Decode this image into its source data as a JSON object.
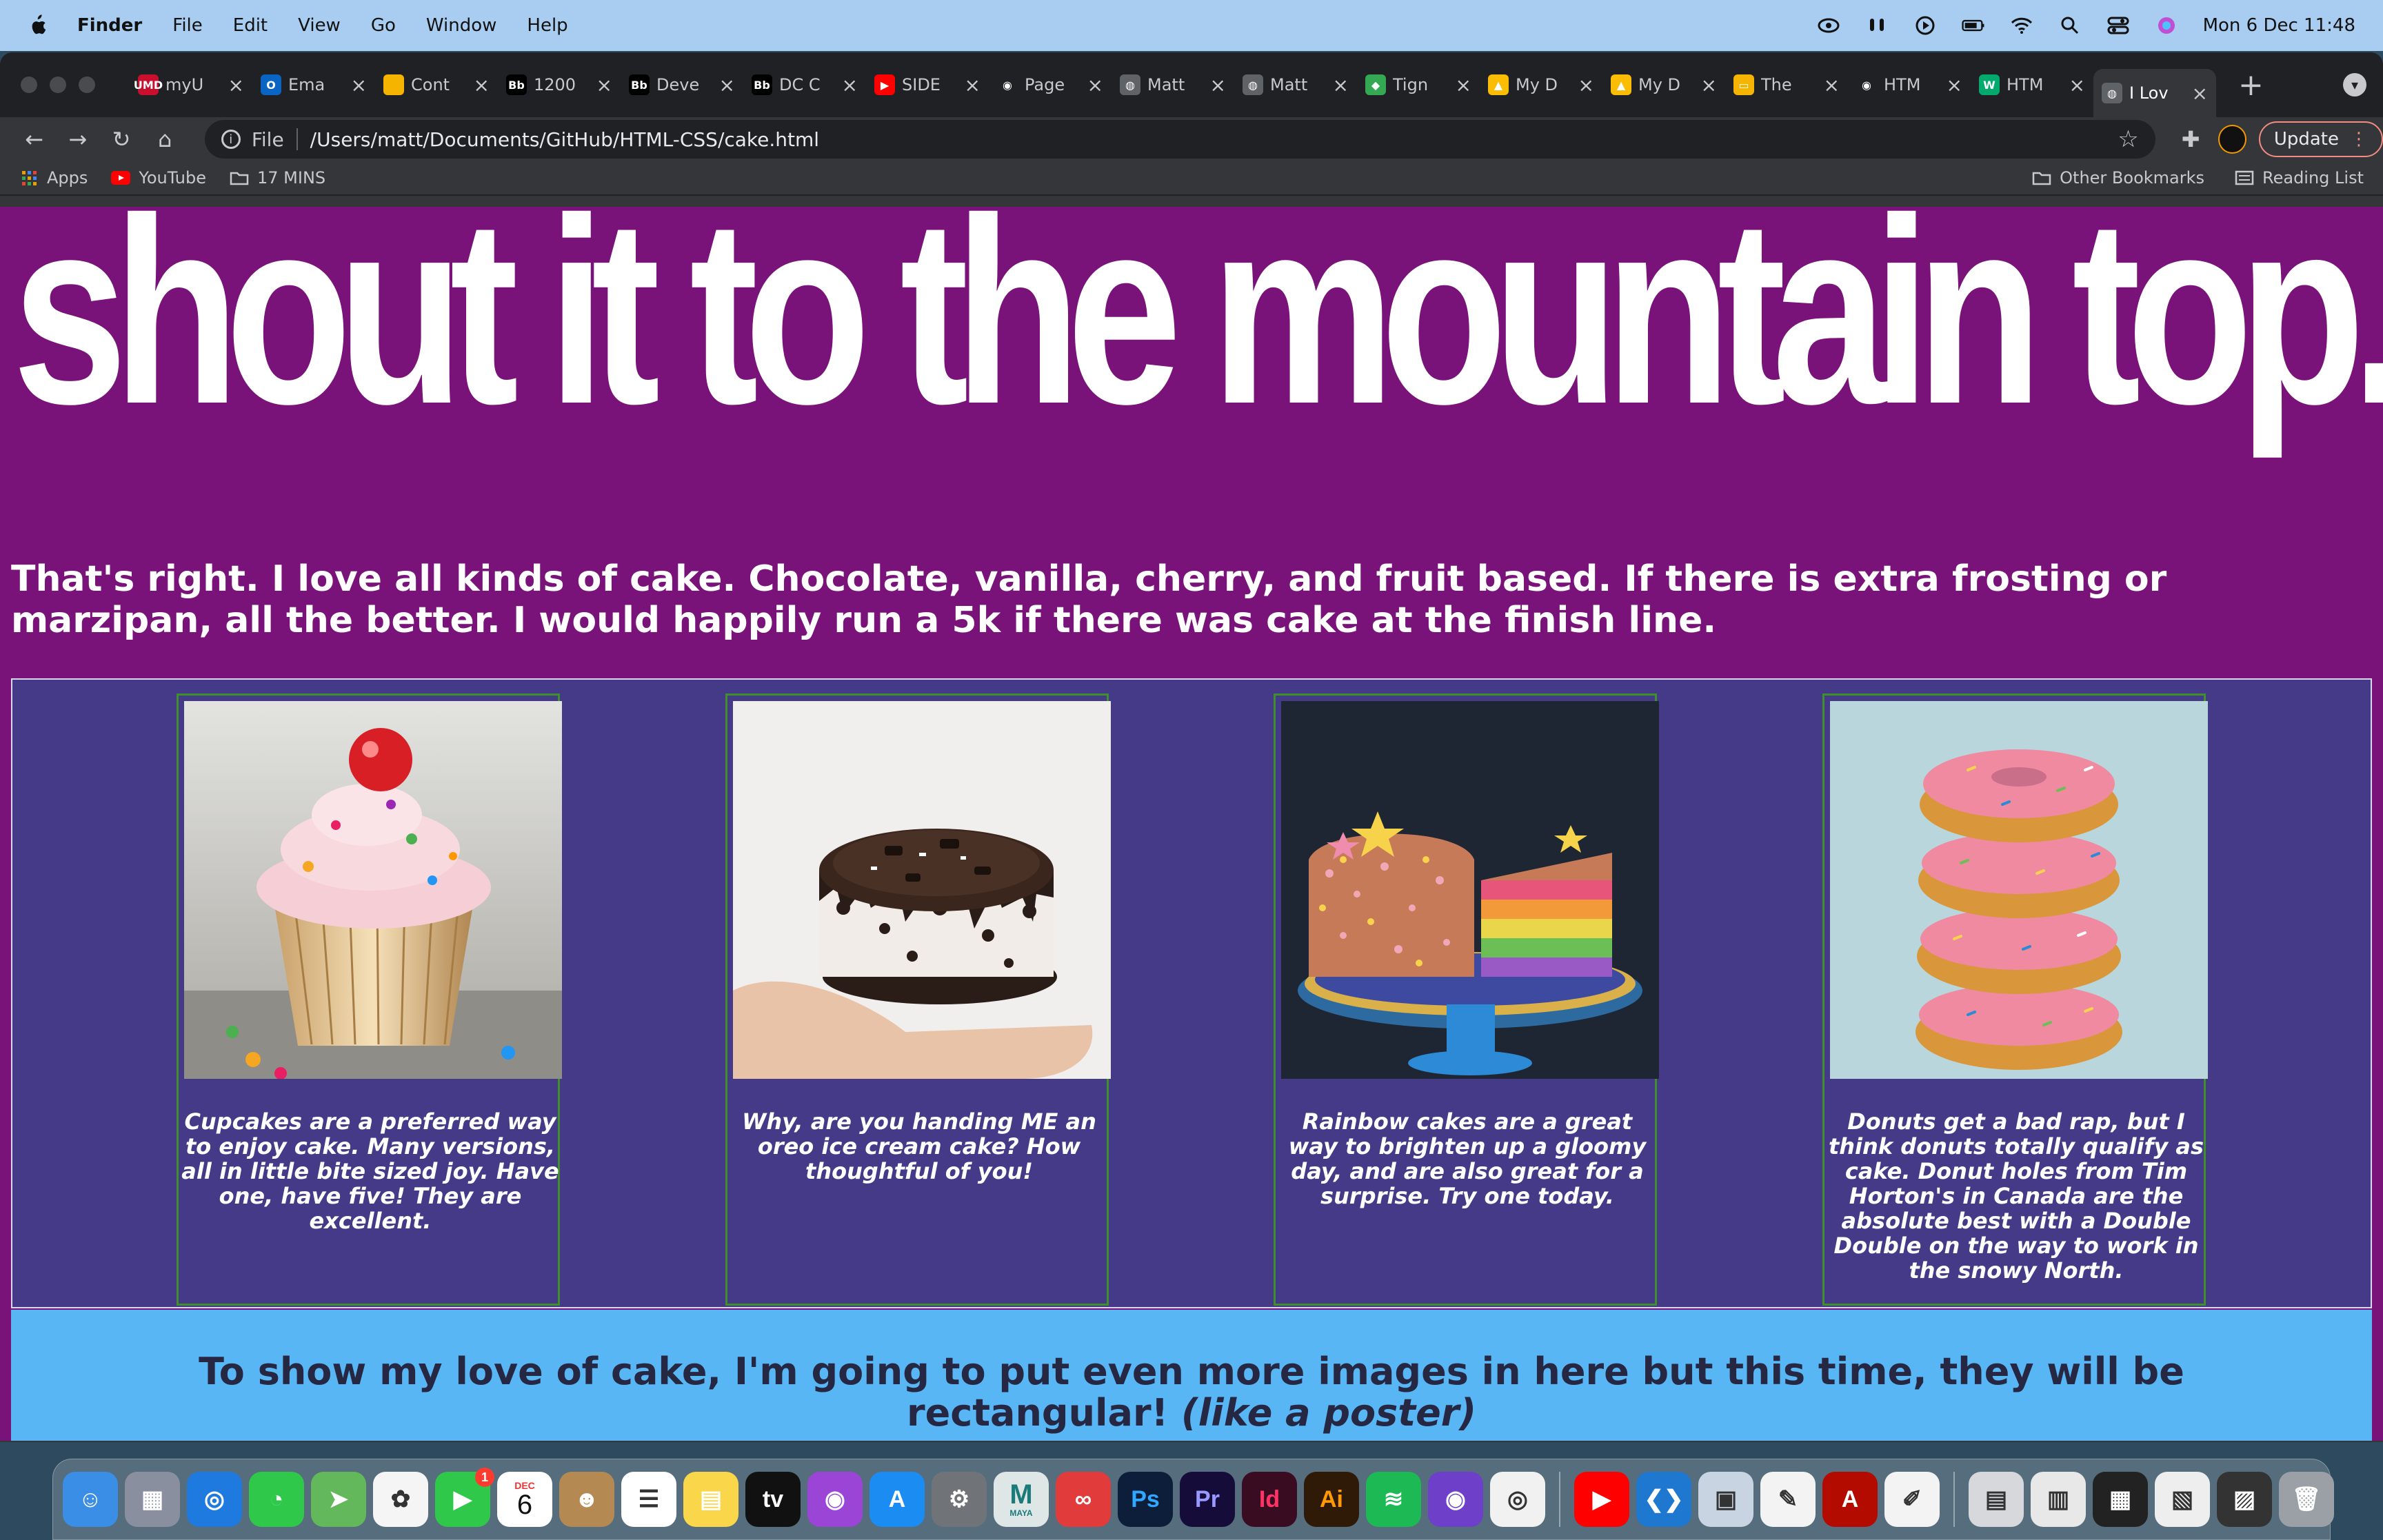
{
  "menubar": {
    "app": "Finder",
    "items": [
      "File",
      "Edit",
      "View",
      "Go",
      "Window",
      "Help"
    ],
    "datetime": "Mon 6 Dec  11:48"
  },
  "browser": {
    "tabs": [
      {
        "label": "myU",
        "icon": "myu-favicon",
        "color": "#c8102e",
        "fav_text": "UMD"
      },
      {
        "label": "Ema",
        "icon": "outlook-icon",
        "color": "#0a64c4",
        "fav_text": "O"
      },
      {
        "label": "Cont",
        "icon": "notes-icon",
        "color": "#f4b400",
        "fav_text": ""
      },
      {
        "label": "1200",
        "icon": "blackboard-icon",
        "color": "#000000",
        "fav_text": "Bb"
      },
      {
        "label": "Deve",
        "icon": "blackboard-icon",
        "color": "#000000",
        "fav_text": "Bb"
      },
      {
        "label": "DC C",
        "icon": "blackboard-icon",
        "color": "#000000",
        "fav_text": "Bb"
      },
      {
        "label": "SIDE",
        "icon": "youtube-icon",
        "color": "#ff0000",
        "fav_text": "▶"
      },
      {
        "label": "Page",
        "icon": "github-icon",
        "color": "#202124",
        "fav_text": "◉"
      },
      {
        "label": "Matt",
        "icon": "globe-icon",
        "color": "#5f6368",
        "fav_text": "◍"
      },
      {
        "label": "Matt",
        "icon": "globe-icon",
        "color": "#5f6368",
        "fav_text": "◍"
      },
      {
        "label": "Tign",
        "icon": "maps-icon",
        "color": "#34a853",
        "fav_text": "◆"
      },
      {
        "label": "My D",
        "icon": "drive-icon",
        "color": "#fbbc04",
        "fav_text": "▲"
      },
      {
        "label": "My D",
        "icon": "drive-icon",
        "color": "#fbbc04",
        "fav_text": "▲"
      },
      {
        "label": "The",
        "icon": "slides-icon",
        "color": "#f4b400",
        "fav_text": "▭"
      },
      {
        "label": "HTM",
        "icon": "github-icon",
        "color": "#202124",
        "fav_text": "◉"
      },
      {
        "label": "HTM",
        "icon": "w3schools-icon",
        "color": "#04aa6d",
        "fav_text": "W"
      },
      {
        "label": "I Lov",
        "icon": "globe-icon",
        "color": "#5f6368",
        "fav_text": "◍",
        "active": true
      }
    ],
    "address": {
      "scheme": "File",
      "path": "/Users/matt/Documents/GitHub/HTML-CSS/cake.html"
    },
    "update_label": "Update",
    "bookmarks": [
      "Apps",
      "YouTube",
      "17 MINS"
    ],
    "bookmarks_right": [
      "Other Bookmarks",
      "Reading List"
    ]
  },
  "page": {
    "headline": "shout it to the mountain top.",
    "intro": "That's right. I love all kinds of cake. Chocolate, vanilla, cherry, and fruit based. If there is extra frosting or marzipan, all the better. I would happily run a 5k if there was cake at the finish line.",
    "cards": [
      {
        "caption": "Cupcakes are a preferred way to enjoy cake. Many versions, all in little bite sized joy. Have one, have five! They are excellent."
      },
      {
        "caption": "Why, are you handing ME an oreo ice cream cake? How thoughtful of you!"
      },
      {
        "caption": "Rainbow cakes are a great way to brighten up a gloomy day, and are also great for a surprise. Try one today."
      },
      {
        "caption": "Donuts get a bad rap, but I think donuts totally qualify as cake. Donut holes from Tim Horton's in Canada are the absolute best with a Double Double on the way to work in the snowy North."
      }
    ],
    "banner_main": "To show my love of cake, I'm going to put even more images in here but this time, they will be rectangular!",
    "banner_em": "(like a poster)"
  },
  "dock": {
    "calendar_month": "DEC",
    "calendar_day": "6",
    "facetime_badge": "1",
    "maya_label": "MAYA",
    "apps": [
      {
        "name": "finder-icon",
        "bg": "#3a8ee6",
        "text": "☺"
      },
      {
        "name": "launchpad-icon",
        "bg": "#8a8fa0",
        "text": "▦"
      },
      {
        "name": "safari-icon",
        "bg": "#1f7ae0",
        "text": "◎"
      },
      {
        "name": "messages-icon",
        "bg": "#2fc84b",
        "text": "◔"
      },
      {
        "name": "maps-icon",
        "bg": "#62b85a",
        "text": "➤"
      },
      {
        "name": "photos-icon",
        "bg": "#f5f5f5",
        "text": "✿"
      },
      {
        "name": "facetime-icon",
        "bg": "#2fc84b",
        "text": "▶"
      },
      {
        "name": "calendar-icon",
        "bg": "#ffffff",
        "text": ""
      },
      {
        "name": "contacts-icon",
        "bg": "#b58a52",
        "text": "☻"
      },
      {
        "name": "reminders-icon",
        "bg": "#ffffff",
        "text": "☰"
      },
      {
        "name": "notes-icon",
        "bg": "#f9d64a",
        "text": "▤"
      },
      {
        "name": "appletv-icon",
        "bg": "#111111",
        "text": "tv"
      },
      {
        "name": "podcasts-icon",
        "bg": "#9b45d6",
        "text": "◉"
      },
      {
        "name": "appstore-icon",
        "bg": "#1b8cf2",
        "text": "A"
      },
      {
        "name": "systemprefs-icon",
        "bg": "#707478",
        "text": "⚙"
      },
      {
        "name": "maya-icon",
        "bg": "#dfe6e6",
        "text": "M"
      },
      {
        "name": "creativecloud-icon",
        "bg": "#e23b3b",
        "text": "∞"
      },
      {
        "name": "photoshop-icon",
        "bg": "#0c1e3a",
        "text": "Ps"
      },
      {
        "name": "premiere-icon",
        "bg": "#160c3a",
        "text": "Pr"
      },
      {
        "name": "indesign-icon",
        "bg": "#3a0c22",
        "text": "Id"
      },
      {
        "name": "illustrator-icon",
        "bg": "#2f1a08",
        "text": "Ai"
      },
      {
        "name": "spotify-icon",
        "bg": "#1db954",
        "text": "≋"
      },
      {
        "name": "githubdesktop-icon",
        "bg": "#6e40c9",
        "text": "◉"
      },
      {
        "name": "chrome-icon",
        "bg": "#f1f1f1",
        "text": "◎"
      },
      {
        "name": "separator",
        "bg": "",
        "text": ""
      },
      {
        "name": "youtube-icon",
        "bg": "#ff0000",
        "text": "▶"
      },
      {
        "name": "vscode-icon",
        "bg": "#1e78d0",
        "text": "❮❯"
      },
      {
        "name": "preview-icon",
        "bg": "#c9d4e3",
        "text": "▣"
      },
      {
        "name": "textedit-icon",
        "bg": "#f3f3f3",
        "text": "✎"
      },
      {
        "name": "acrobat-icon",
        "bg": "#b30b00",
        "text": "A"
      },
      {
        "name": "scripteditor-icon",
        "bg": "#f3f3f3",
        "text": "✐"
      },
      {
        "name": "separator",
        "bg": "",
        "text": ""
      },
      {
        "name": "downloads-icon",
        "bg": "#d6d8dc",
        "text": "▤"
      },
      {
        "name": "document-stack-icon",
        "bg": "#e8e8e8",
        "text": "▥"
      },
      {
        "name": "screenshot-stack-icon",
        "bg": "#222222",
        "text": "▦"
      },
      {
        "name": "pdf-stack-icon",
        "bg": "#eeeeee",
        "text": "▧"
      },
      {
        "name": "folder-stack-icon",
        "bg": "#333333",
        "text": "▨"
      },
      {
        "name": "trash-icon",
        "bg": "#9aa0a6",
        "text": "🗑"
      }
    ]
  }
}
